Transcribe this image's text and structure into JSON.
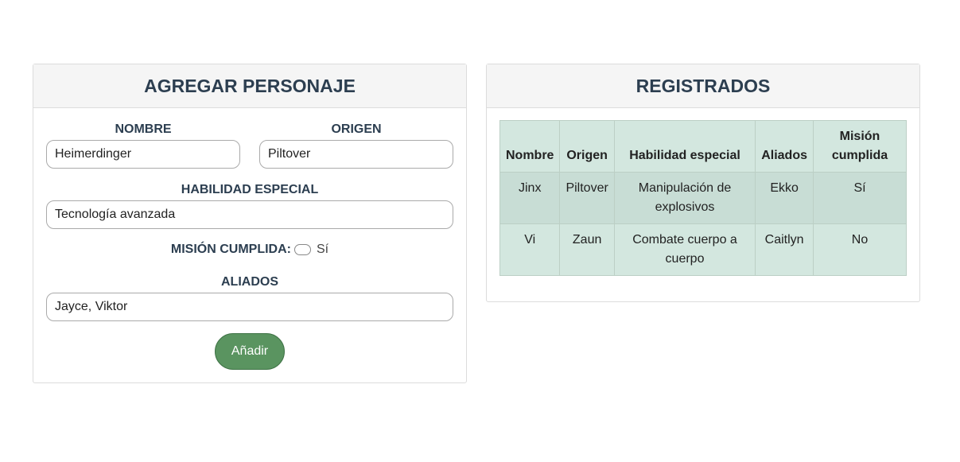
{
  "form": {
    "title": "AGREGAR PERSONAJE",
    "nombre_label": "NOMBRE",
    "nombre_value": "Heimerdinger",
    "origen_label": "ORIGEN",
    "origen_value": "Piltover",
    "habilidad_label": "HABILIDAD ESPECIAL",
    "habilidad_value": "Tecnología avanzada",
    "mision_label": "MISIÓN CUMPLIDA:",
    "mision_checked": false,
    "mision_option": "Sí",
    "aliados_label": "ALIADOS",
    "aliados_value": "Jayce, Viktor",
    "submit_label": "Añadir"
  },
  "registrados": {
    "title": "REGISTRADOS",
    "columns": [
      "Nombre",
      "Origen",
      "Habilidad especial",
      "Aliados",
      "Misión cumplida"
    ],
    "rows": [
      [
        "Jinx",
        "Piltover",
        "Manipulación de explosivos",
        "Ekko",
        "Sí"
      ],
      [
        "Vi",
        "Zaun",
        "Combate cuerpo a cuerpo",
        "Caitlyn",
        "No"
      ]
    ]
  },
  "colors": {
    "heading": "#2c3e50",
    "button": "#5a9460",
    "table_header": "#d3e7df",
    "table_row_alt": "#c8ddd5"
  }
}
